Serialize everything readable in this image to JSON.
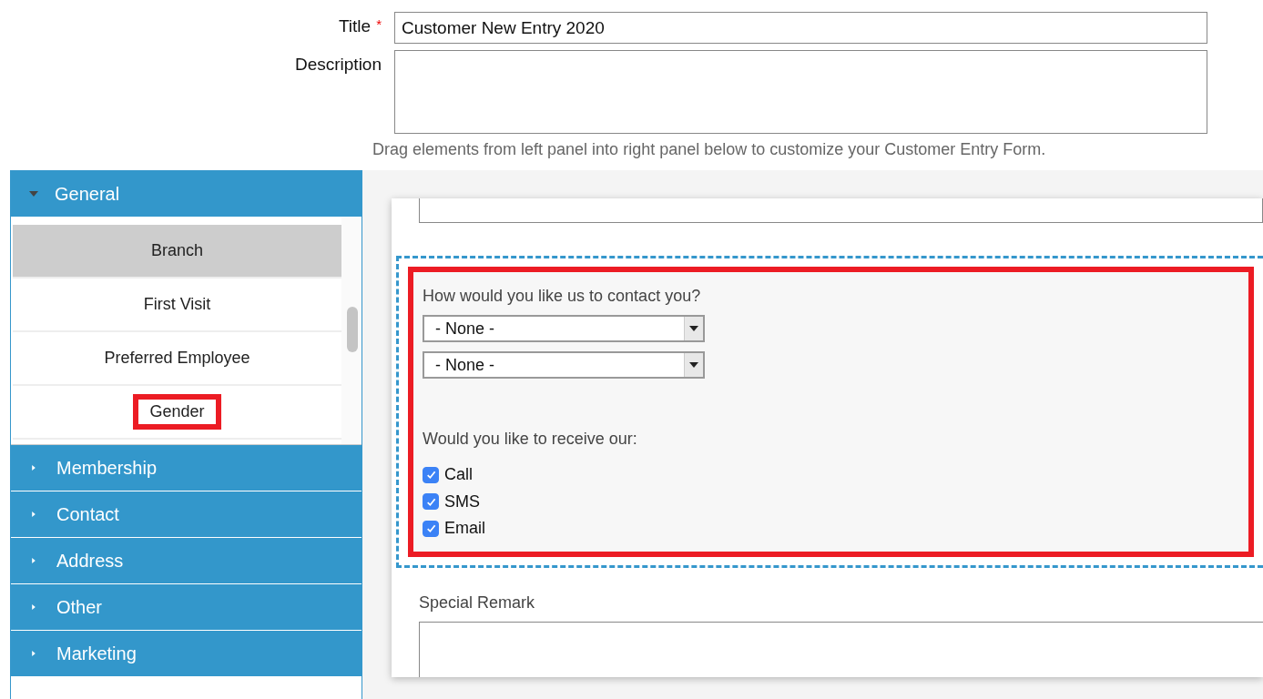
{
  "form": {
    "title_label": "Title",
    "required_mark": "*",
    "title_value": "Customer New Entry 2020",
    "description_label": "Description",
    "hint": "Drag elements from left panel into right panel below to customize your Customer Entry Form."
  },
  "palette": {
    "groups": [
      {
        "label": "General",
        "expanded": true,
        "items": [
          {
            "label": "Branch",
            "selected": true,
            "highlighted": false
          },
          {
            "label": "First Visit",
            "selected": false,
            "highlighted": false
          },
          {
            "label": "Preferred Employee",
            "selected": false,
            "highlighted": false
          },
          {
            "label": "Gender",
            "selected": false,
            "highlighted": true
          }
        ]
      },
      {
        "label": "Membership",
        "expanded": false
      },
      {
        "label": "Contact",
        "expanded": false
      },
      {
        "label": "Address",
        "expanded": false
      },
      {
        "label": "Other",
        "expanded": false
      },
      {
        "label": "Marketing",
        "expanded": false
      }
    ]
  },
  "canvas": {
    "fields": [
      {
        "kind": "input"
      },
      {
        "kind": "contact",
        "drop_target": true,
        "highlighted": true,
        "question": "How would you like us to contact you?",
        "selects": [
          "- None -",
          "- None -"
        ],
        "prompt": "Would you like to receive our:",
        "options": [
          {
            "label": "Call",
            "checked": true
          },
          {
            "label": "SMS",
            "checked": true
          },
          {
            "label": "Email",
            "checked": true
          }
        ]
      },
      {
        "kind": "textarea",
        "label": "Special Remark"
      }
    ]
  }
}
